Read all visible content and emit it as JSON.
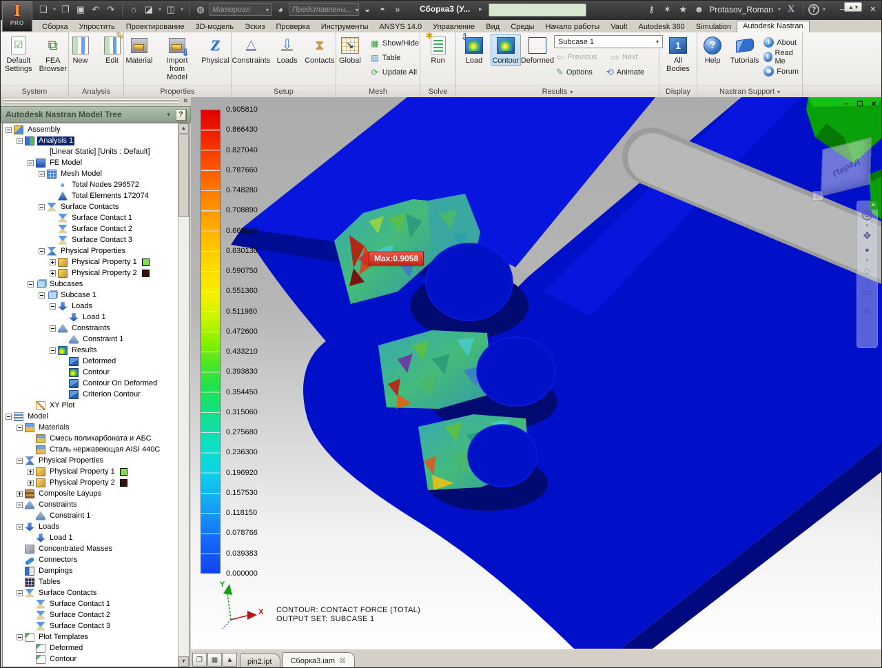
{
  "titlebar": {
    "badge": "PRO",
    "doc_title": "Сборка3 (У...",
    "material": "Материал",
    "representation": "Представлени...",
    "user": "Protasov_Roman"
  },
  "icons": {
    "new_doc": "❏",
    "open": "❐",
    "save": "▣",
    "undo": "↶",
    "redo": "↷",
    "home": "⌂",
    "shaded_view": "◪",
    "visibility": "◫",
    "appearance_globe": "◍",
    "color_wheel": "◕",
    "filter_a": "◒",
    "filter_b": "◓",
    "overflow": "»",
    "title_arrow": "▸",
    "key": "⚷",
    "comm_center": "✶",
    "favorites": "★",
    "user": "☻",
    "exchange": "X",
    "help": "?",
    "caret": "▾",
    "win_min": "─",
    "win_restore": "❐",
    "win_close": "✕",
    "collapse_pin": "▲",
    "prev_arrow": "⇦",
    "next_arrow": "⇨",
    "options_pencil": "✎",
    "animate": "⟲",
    "show_hide": "▦",
    "table": "▤",
    "update_all": "⟳",
    "settings_check": "☑",
    "fea_tree": "⧉",
    "z_block": "Z",
    "constraint_tri": "△",
    "load_arrow": "⇩",
    "hourglass": "⧗",
    "load_cube_arrow": "⇩",
    "all_bodies_num": "1",
    "info": "ⓘ",
    "forum": "☻",
    "panel_close": "✕",
    "panel_help": "?",
    "cascade": "❐",
    "tile": "▦",
    "tab_up": "▲",
    "tab_close": "☒",
    "mdi_min": "─",
    "mdi_restore": "❐",
    "mdi_close": "✕",
    "vc_home": "⌂",
    "nav_close": "✕",
    "nav_wheel": "◎",
    "nav_pan": "❖",
    "nav_zoom": "●",
    "nav_orbit": "◌",
    "nav_look": "▭",
    "nav_collapse": "⊖",
    "scroll_up": "▲",
    "scroll_down": "▼"
  },
  "ribbon_tabs": [
    {
      "label": "Сборка",
      "active": false
    },
    {
      "label": "Упростить",
      "active": false
    },
    {
      "label": "Проектирование",
      "active": false
    },
    {
      "label": "3D-модель",
      "active": false
    },
    {
      "label": "Эскиз",
      "active": false
    },
    {
      "label": "Проверка",
      "active": false
    },
    {
      "label": "Инструменты",
      "active": false
    },
    {
      "label": "ANSYS 14.0",
      "active": false
    },
    {
      "label": "Управление",
      "active": false
    },
    {
      "label": "Вид",
      "active": false
    },
    {
      "label": "Среды",
      "active": false
    },
    {
      "label": "Начало работы",
      "active": false
    },
    {
      "label": "Vault",
      "active": false
    },
    {
      "label": "Autodesk 360",
      "active": false
    },
    {
      "label": "Simulation",
      "active": false
    },
    {
      "label": "Autodesk Nastran",
      "active": true
    }
  ],
  "ribbon": {
    "system": {
      "default_settings": "Default Settings",
      "fea_browser": "FEA Browser"
    },
    "analysis": {
      "new": "New",
      "edit": "Edit"
    },
    "properties": {
      "material": "Material",
      "import_from_model": "Import from Model",
      "physical": "Physical"
    },
    "setup": {
      "constraints": "Constraints",
      "loads": "Loads",
      "contacts": "Contacts"
    },
    "mesh": {
      "global": "Global",
      "show_hide": "Show/Hide",
      "table": "Table",
      "update_all": "Update All"
    },
    "solve": {
      "run": "Run"
    },
    "results": {
      "load": "Load",
      "contour": "Contour",
      "deformed": "Deformed",
      "subcase": "Subcase 1",
      "previous": "Previous",
      "next": "Next",
      "options": "Options",
      "animate": "Animate"
    },
    "display": {
      "all_bodies": "All Bodies"
    },
    "support": {
      "help": "Help",
      "tutorials": "Tutorials",
      "about": "About",
      "read_me": "Read Me",
      "forum": "Forum"
    },
    "group_labels": [
      "System",
      "Analysis",
      "Properties",
      "Setup",
      "Mesh",
      "Solve",
      "Results",
      "Display",
      "Nastran Support"
    ]
  },
  "panel": {
    "title": "Autodesk Nastran Model Tree"
  },
  "tree": [
    {
      "t": "Assembly",
      "d": 0,
      "i": "assembly",
      "e": "-"
    },
    {
      "t": "Analysis 1",
      "d": 1,
      "i": "analysis",
      "e": "-",
      "s": true
    },
    {
      "t": "[Linear Static] [Units : Default]",
      "d": 2,
      "i": "none",
      "e": ""
    },
    {
      "t": "FE Model",
      "d": 2,
      "i": "femodel",
      "e": "-"
    },
    {
      "t": "Mesh Model",
      "d": 3,
      "i": "mesh",
      "e": "-"
    },
    {
      "t": "Total Nodes 296572",
      "d": 4,
      "i": "node",
      "e": ""
    },
    {
      "t": "Total Elements 172074",
      "d": 4,
      "i": "element",
      "e": ""
    },
    {
      "t": "Surface Contacts",
      "d": 3,
      "i": "contacts",
      "e": "-"
    },
    {
      "t": "Surface Contact 1",
      "d": 4,
      "i": "contact",
      "e": ""
    },
    {
      "t": "Surface Contact 2",
      "d": 4,
      "i": "contact",
      "e": ""
    },
    {
      "t": "Surface Contact 3",
      "d": 4,
      "i": "contact",
      "e": ""
    },
    {
      "t": "Physical Properties",
      "d": 3,
      "i": "physprops",
      "e": "-"
    },
    {
      "t": "Physical Property 1",
      "d": 4,
      "i": "physprop",
      "e": "+",
      "w": "#7de24a"
    },
    {
      "t": "Physical Property 2",
      "d": 4,
      "i": "physprop",
      "e": "+",
      "w": "#3a0f0f"
    },
    {
      "t": "Subcases",
      "d": 2,
      "i": "subcases",
      "e": "-"
    },
    {
      "t": "Subcase 1",
      "d": 3,
      "i": "subcase",
      "e": "-"
    },
    {
      "t": "Loads",
      "d": 4,
      "i": "loads",
      "e": "-"
    },
    {
      "t": "Load 1",
      "d": 5,
      "i": "load",
      "e": ""
    },
    {
      "t": "Constraints",
      "d": 4,
      "i": "constraints",
      "e": "-"
    },
    {
      "t": "Constraint 1",
      "d": 5,
      "i": "constraint",
      "e": ""
    },
    {
      "t": "Results",
      "d": 4,
      "i": "results",
      "e": "-"
    },
    {
      "t": "Deformed",
      "d": 5,
      "i": "cube",
      "e": ""
    },
    {
      "t": "Contour",
      "d": 5,
      "i": "contourcube",
      "e": ""
    },
    {
      "t": "Contour On Deformed",
      "d": 5,
      "i": "cube",
      "e": ""
    },
    {
      "t": "Criterion Contour",
      "d": 5,
      "i": "cube",
      "e": ""
    },
    {
      "t": "XY Plot",
      "d": 2,
      "i": "xyplot",
      "e": ""
    },
    {
      "t": "Model",
      "d": 0,
      "i": "model",
      "e": "-"
    },
    {
      "t": "Materials",
      "d": 1,
      "i": "materials",
      "e": "-"
    },
    {
      "t": "Смесь поликарбоната и АБС",
      "d": 2,
      "i": "material",
      "e": ""
    },
    {
      "t": "Сталь нержавеющая AISI 440C",
      "d": 2,
      "i": "material",
      "e": ""
    },
    {
      "t": "Physical Properties",
      "d": 1,
      "i": "physprops",
      "e": "-"
    },
    {
      "t": "Physical Property 1",
      "d": 2,
      "i": "physprop",
      "e": "+",
      "w": "#7de24a"
    },
    {
      "t": "Physical Property 2",
      "d": 2,
      "i": "physprop",
      "e": "+",
      "w": "#3a0f0f"
    },
    {
      "t": "Composite Layups",
      "d": 1,
      "i": "composite",
      "e": "+"
    },
    {
      "t": "Constraints",
      "d": 1,
      "i": "constraints",
      "e": "-"
    },
    {
      "t": "Constraint 1",
      "d": 2,
      "i": "constraint",
      "e": ""
    },
    {
      "t": "Loads",
      "d": 1,
      "i": "loads",
      "e": "-"
    },
    {
      "t": "Load 1",
      "d": 2,
      "i": "load",
      "e": ""
    },
    {
      "t": "Concentrated Masses",
      "d": 1,
      "i": "mass",
      "e": ""
    },
    {
      "t": "Connectors",
      "d": 1,
      "i": "connector",
      "e": ""
    },
    {
      "t": "Dampings",
      "d": 1,
      "i": "damping",
      "e": ""
    },
    {
      "t": "Tables",
      "d": 1,
      "i": "tables",
      "e": ""
    },
    {
      "t": "Surface Contacts",
      "d": 1,
      "i": "contacts",
      "e": "-"
    },
    {
      "t": "Surface Contact 1",
      "d": 2,
      "i": "contact",
      "e": ""
    },
    {
      "t": "Surface Contact 2",
      "d": 2,
      "i": "contact",
      "e": ""
    },
    {
      "t": "Surface Contact 3",
      "d": 2,
      "i": "contact",
      "e": ""
    },
    {
      "t": "Plot Templates",
      "d": 1,
      "i": "plottemplates",
      "e": "-"
    },
    {
      "t": "Deformed",
      "d": 2,
      "i": "plottemplate",
      "e": ""
    },
    {
      "t": "Contour",
      "d": 2,
      "i": "plottemplate",
      "e": ""
    }
  ],
  "legend": {
    "values": [
      "0.905810",
      "0.866430",
      "0.827040",
      "0.787660",
      "0.748280",
      "0.708890",
      "0.669510",
      "0.630130",
      "0.590750",
      "0.551360",
      "0.511980",
      "0.472600",
      "0.433210",
      "0.393830",
      "0.354450",
      "0.315060",
      "0.275680",
      "0.236300",
      "0.196920",
      "0.157530",
      "0.118150",
      "0.078766",
      "0.039383",
      "0.000000"
    ]
  },
  "viewport": {
    "max_flag": "Max:0.9058",
    "contour_title": "CONTOUR: CONTACT FORCE (TOTAL)",
    "output_set": "OUTPUT SET: SUBCASE 1",
    "viewcube_face": "Перед",
    "axis_x": "X",
    "axis_y": "Y"
  },
  "doc_tabs": [
    {
      "label": "pin2.ipt",
      "active": false
    },
    {
      "label": "Сборка3.iam",
      "active": true
    }
  ],
  "colors": {
    "selection": "#0a246a",
    "model_blue": "#0010c0",
    "max_flag": "#d83028",
    "panel_header": "#9aaa9a",
    "contour_active": "#cfe3f5"
  }
}
